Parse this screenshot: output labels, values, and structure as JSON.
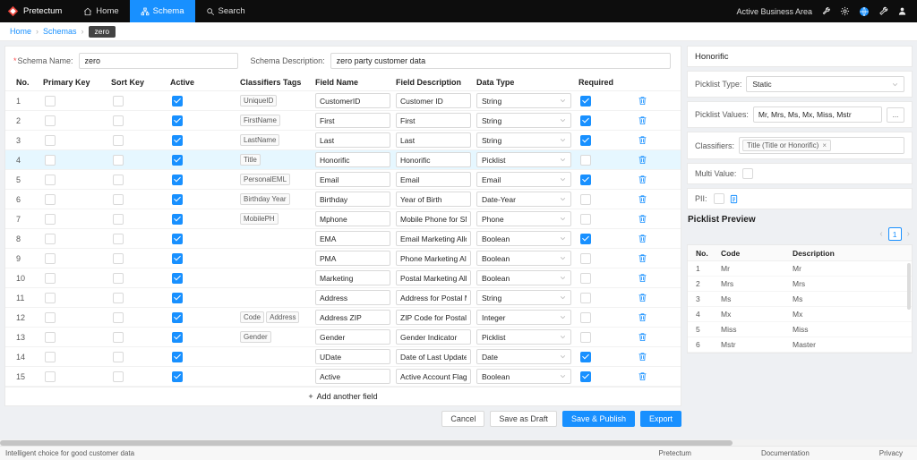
{
  "colors": {
    "accent": "#1890ff",
    "navbar_bg": "#0d0d0d",
    "selected_row_bg": "#e6f7ff",
    "badge_bg": "#434343"
  },
  "navbar": {
    "brand": "Pretectum",
    "items": [
      {
        "label": "Home",
        "active": false
      },
      {
        "label": "Schema",
        "active": true
      },
      {
        "label": "Search",
        "active": false
      }
    ],
    "business_area_label": "Active Business Area",
    "icons": [
      "wrench-icon",
      "gear-icon",
      "globe-icon",
      "tools-icon",
      "user-icon"
    ]
  },
  "breadcrumb": {
    "links": [
      "Home",
      "Schemas"
    ],
    "separator": "›",
    "current": "zero"
  },
  "schema_form": {
    "required_mark": "*",
    "name_label": "Schema Name:",
    "name_value": "zero",
    "description_label": "Schema Description:",
    "description_value": "zero party customer data"
  },
  "fields_table": {
    "headers": [
      "No.",
      "Primary Key",
      "Sort Key",
      "Active",
      "Classifiers Tags",
      "Field Name",
      "Field Description",
      "Data Type",
      "Required"
    ],
    "rows": [
      {
        "no": "1",
        "primary_key": false,
        "sort_key": false,
        "active": true,
        "tags": [
          "UniqueID"
        ],
        "field_name": "CustomerID",
        "field_description": "Customer ID",
        "data_type": "String",
        "required": true,
        "selected": false
      },
      {
        "no": "2",
        "primary_key": false,
        "sort_key": false,
        "active": true,
        "tags": [
          "FirstName"
        ],
        "field_name": "First",
        "field_description": "First",
        "data_type": "String",
        "required": true,
        "selected": false
      },
      {
        "no": "3",
        "primary_key": false,
        "sort_key": false,
        "active": true,
        "tags": [
          "LastName"
        ],
        "field_name": "Last",
        "field_description": "Last",
        "data_type": "String",
        "required": true,
        "selected": false
      },
      {
        "no": "4",
        "primary_key": false,
        "sort_key": false,
        "active": true,
        "tags": [
          "Title"
        ],
        "field_name": "Honorific",
        "field_description": "Honorific",
        "data_type": "Picklist",
        "required": false,
        "selected": true
      },
      {
        "no": "5",
        "primary_key": false,
        "sort_key": false,
        "active": true,
        "tags": [
          "PersonalEML"
        ],
        "field_name": "Email",
        "field_description": "Email",
        "data_type": "Email",
        "required": true,
        "selected": false
      },
      {
        "no": "6",
        "primary_key": false,
        "sort_key": false,
        "active": true,
        "tags": [
          "Birthday Year"
        ],
        "field_name": "Birthday",
        "field_description": "Year of Birth",
        "data_type": "Date-Year",
        "required": false,
        "selected": false
      },
      {
        "no": "7",
        "primary_key": false,
        "sort_key": false,
        "active": true,
        "tags": [
          "MobilePH"
        ],
        "field_name": "Mphone",
        "field_description": "Mobile Phone for SMS",
        "data_type": "Phone",
        "required": false,
        "selected": false
      },
      {
        "no": "8",
        "primary_key": false,
        "sort_key": false,
        "active": true,
        "tags": [],
        "field_name": "EMA",
        "field_description": "Email Marketing Allowed",
        "data_type": "Boolean",
        "required": true,
        "selected": false
      },
      {
        "no": "9",
        "primary_key": false,
        "sort_key": false,
        "active": true,
        "tags": [],
        "field_name": "PMA",
        "field_description": "Phone Marketing Allowed",
        "data_type": "Boolean",
        "required": false,
        "selected": false
      },
      {
        "no": "10",
        "primary_key": false,
        "sort_key": false,
        "active": true,
        "tags": [],
        "field_name": "Marketing",
        "field_description": "Postal Marketing Allowed",
        "data_type": "Boolean",
        "required": false,
        "selected": false
      },
      {
        "no": "11",
        "primary_key": false,
        "sort_key": false,
        "active": true,
        "tags": [],
        "field_name": "Address",
        "field_description": "Address for Postal Marketing",
        "data_type": "String",
        "required": false,
        "selected": false
      },
      {
        "no": "12",
        "primary_key": false,
        "sort_key": false,
        "active": true,
        "tags": [
          "Code",
          "Address"
        ],
        "field_name": "Address ZIP",
        "field_description": "ZIP Code for Postal Marketing",
        "data_type": "Integer",
        "required": false,
        "selected": false
      },
      {
        "no": "13",
        "primary_key": false,
        "sort_key": false,
        "active": true,
        "tags": [
          "Gender"
        ],
        "field_name": "Gender",
        "field_description": "Gender Indicator",
        "data_type": "Picklist",
        "required": false,
        "selected": false
      },
      {
        "no": "14",
        "primary_key": false,
        "sort_key": false,
        "active": true,
        "tags": [],
        "field_name": "UDate",
        "field_description": "Date of Last Update",
        "data_type": "Date",
        "required": true,
        "selected": false
      },
      {
        "no": "15",
        "primary_key": false,
        "sort_key": false,
        "active": true,
        "tags": [],
        "field_name": "Active",
        "field_description": "Active Account Flag",
        "data_type": "Boolean",
        "required": true,
        "selected": false
      }
    ],
    "add_icon": "+",
    "add_field_label": "Add another field"
  },
  "actions": {
    "cancel": "Cancel",
    "save_draft": "Save as Draft",
    "save_publish": "Save & Publish",
    "export": "Export"
  },
  "detail_panel": {
    "title": "Honorific",
    "picklist_type_label": "Picklist Type:",
    "picklist_type_value": "Static",
    "picklist_values_label": "Picklist Values:",
    "picklist_values_value": "Mr, Mrs, Ms, Mx, Miss, Mstr",
    "more_button": "...",
    "classifiers_label": "Classifiers:",
    "classifiers_tag": "Title (Title or Honorific)",
    "remove_tag": "×",
    "multi_value_label": "Multi Value:",
    "multi_value_checked": false,
    "pii_label": "PII:",
    "pii_checked": false
  },
  "picklist_preview": {
    "title": "Picklist Preview",
    "prev": "‹",
    "page": "1",
    "next": "›",
    "headers": [
      "No.",
      "Code",
      "Description"
    ],
    "rows": [
      {
        "no": "1",
        "code": "Mr",
        "description": "Mr"
      },
      {
        "no": "2",
        "code": "Mrs",
        "description": "Mrs"
      },
      {
        "no": "3",
        "code": "Ms",
        "description": "Ms"
      },
      {
        "no": "4",
        "code": "Mx",
        "description": "Mx"
      },
      {
        "no": "5",
        "code": "Miss",
        "description": "Miss"
      },
      {
        "no": "6",
        "code": "Mstr",
        "description": "Master"
      }
    ]
  },
  "page_footer": {
    "tagline": "Intelligent choice for good customer data",
    "links": [
      "Pretectum",
      "Documentation",
      "Privacy"
    ]
  }
}
